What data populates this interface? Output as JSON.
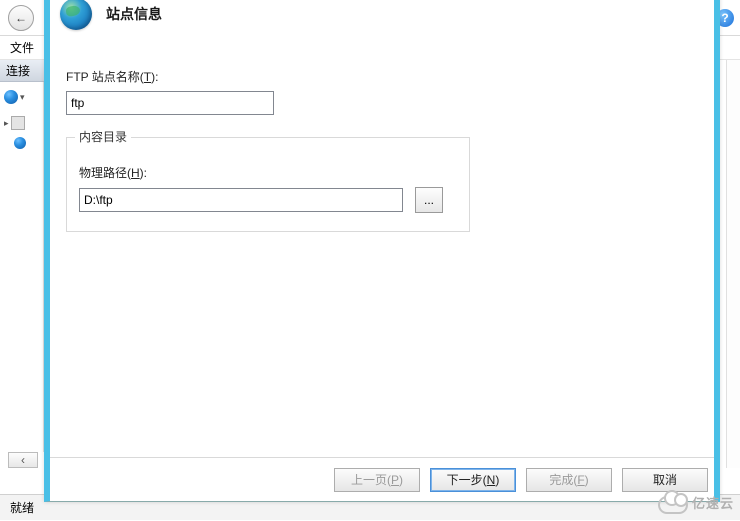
{
  "bg": {
    "back_arrow": "←",
    "help": "?",
    "menu_file": "文件",
    "connections_title": "连接",
    "tree_arrow": "▾",
    "expand": "▸",
    "scroll_left": "‹",
    "status": "就绪"
  },
  "wizard": {
    "title": "站点信息",
    "site_name_label_pre": "FTP 站点名称(",
    "site_name_hotkey": "T",
    "site_name_label_post": "):",
    "site_name_value": "ftp",
    "content_legend": "内容目录",
    "path_label_pre": "物理路径(",
    "path_hotkey": "H",
    "path_label_post": "):",
    "path_value": "D:\\ftp",
    "browse_dots": "...",
    "buttons": {
      "prev_pre": "上一页(",
      "prev_hot": "P",
      "prev_post": ")",
      "next_pre": "下一步(",
      "next_hot": "N",
      "next_post": ")",
      "finish_pre": "完成(",
      "finish_hot": "F",
      "finish_post": ")",
      "cancel": "取消"
    }
  },
  "watermark": "亿速云"
}
